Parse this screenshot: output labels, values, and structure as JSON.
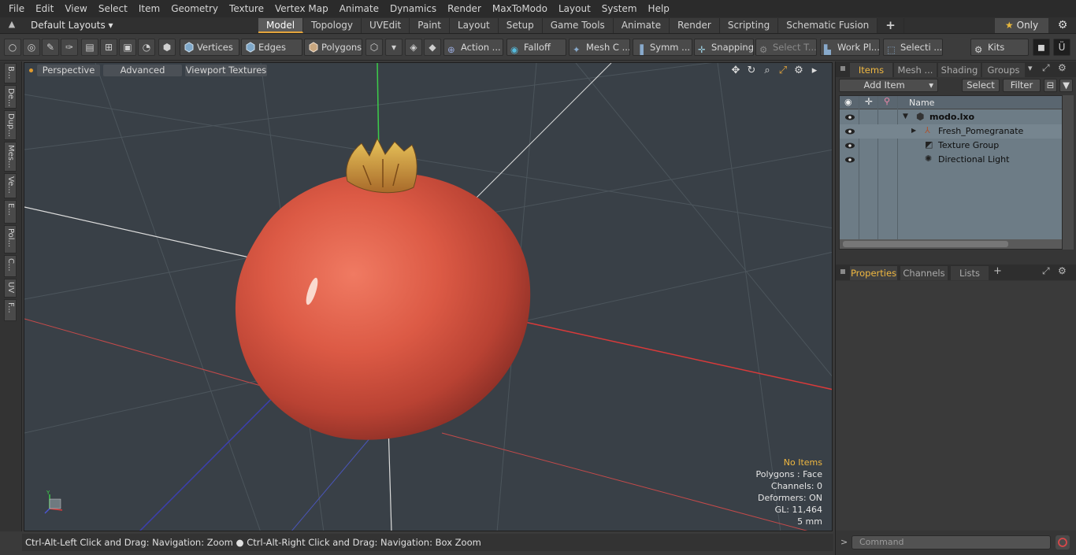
{
  "menu": [
    "File",
    "Edit",
    "View",
    "Select",
    "Item",
    "Geometry",
    "Texture",
    "Vertex Map",
    "Animate",
    "Dynamics",
    "Render",
    "MaxToModo",
    "Layout",
    "System",
    "Help"
  ],
  "layout_selector": "Default Layouts ▾",
  "layout_tabs": [
    "Model",
    "Topology",
    "UVEdit",
    "Paint",
    "Layout",
    "Setup",
    "Game Tools",
    "Animate",
    "Render",
    "Scripting",
    "Schematic Fusion"
  ],
  "active_tab": "Model",
  "only_label": "Only",
  "toolbar": {
    "vertices": "Vertices",
    "edges": "Edges",
    "polygons": "Polygons",
    "action": "Action ...",
    "falloff": "Falloff",
    "mesh_c": "Mesh C ...",
    "symm": "Symm ...",
    "snapping": "Snapping",
    "select_t": "Select T...",
    "work_pl": "Work Pl...",
    "selecti": "Selecti ...",
    "kits": "Kits"
  },
  "left_tabs": [
    "B...",
    "De...",
    "Dup...",
    "Mes...",
    "Ve...",
    "E...",
    "Pol...",
    "C...",
    "UV",
    "F..."
  ],
  "viewport": {
    "perspective": "Perspective",
    "advanced": "Advanced",
    "viewport_textures": "Viewport Textures",
    "info": {
      "no_items": "No Items",
      "polygons": "Polygons : Face",
      "channels": "Channels: 0",
      "deformers": "Deformers: ON",
      "gl": "GL: 11,464",
      "scale": "5 mm"
    }
  },
  "status": "Ctrl-Alt-Left Click and Drag: Navigation: Zoom ● Ctrl-Alt-Right Click and Drag: Navigation: Box Zoom",
  "items_panel": {
    "tabs": [
      "Items",
      "Mesh ...",
      "Shading",
      "Groups"
    ],
    "add_item": "Add Item",
    "select": "Select",
    "filter": "Filter",
    "name_header": "Name",
    "rows": [
      {
        "label": "modo.lxo"
      },
      {
        "label": "Fresh_Pomegranate"
      },
      {
        "label": "Texture Group"
      },
      {
        "label": "Directional Light"
      }
    ]
  },
  "properties_panel": {
    "tabs": [
      "Properties",
      "Channels",
      "Lists"
    ]
  },
  "command_placeholder": "Command",
  "colors": {
    "accent": "#e3a43c",
    "viewport_bg": "#394047",
    "pomegranate": "#d94f3c"
  }
}
